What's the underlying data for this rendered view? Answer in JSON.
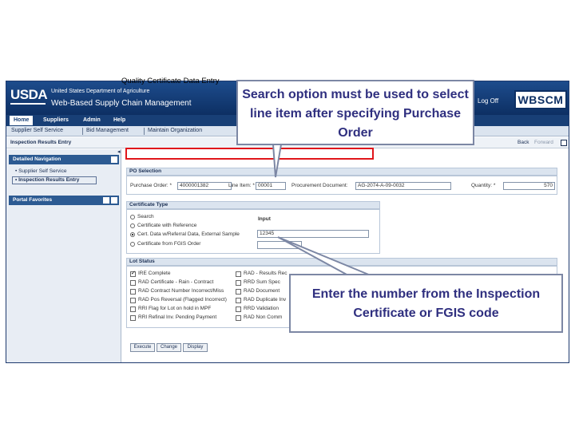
{
  "header": {
    "agency": "USDA",
    "department": "United States Department of Agriculture",
    "system_name": "Web-Based Supply Chain Management",
    "logoff": "Log Off",
    "logo": "WBSCM"
  },
  "top_nav": [
    "Home",
    "Suppliers",
    "Admin",
    "Help"
  ],
  "sub_nav": [
    "Supplier Self Service",
    "Bid Management",
    "Maintain Organization"
  ],
  "path": "Inspection Results Entry",
  "history": {
    "back": "Back",
    "forward": "Forward"
  },
  "left_nav": {
    "detailed_title": "Detailed Navigation",
    "items": [
      "Supplier Self Service",
      "Inspection Results Entry"
    ],
    "portal_title": "Portal Favorites"
  },
  "page_title": "Quality Certificate Data Entry",
  "po_selection": {
    "title": "PO Selection",
    "purchase_order_label": "Purchase Order: *",
    "purchase_order_value": "4000001382",
    "line_item_label": "Line Item: *",
    "line_item_value": "00001",
    "procurement_doc_label": "Procurement Document:",
    "procurement_doc_value": "AG-2074-A-09-0032",
    "quantity_label": "Quantity: *",
    "quantity_value": "570"
  },
  "certificate_type": {
    "title": "Certificate Type",
    "input_header": "Input",
    "options": [
      "Search",
      "Certificate with Reference",
      "Cert. Data w/Referral Data, External Sample",
      "Certificate from FGIS Order"
    ],
    "selected_index": 2,
    "input_value": "12345"
  },
  "lot_status": {
    "title": "Lot Status",
    "left": [
      "IRE Complete",
      "RAD Certificate - Rain - Contract",
      "RAD Contract Number Incorrect/Miss",
      "RAD Pos Reversal (Flagged Incorrect)",
      "RRI Flag for Lot on hold in MPF",
      "RRI Refinal Inv. Pending Payment"
    ],
    "left_checked": [
      true,
      false,
      false,
      false,
      false,
      false
    ],
    "right": [
      "RAD - Results Rec",
      "RRD Sum Spec",
      "RAD Document",
      "RAD Duplicate Inv",
      "RRD Validation",
      "RAD Non Comm"
    ]
  },
  "buttons": [
    "Execute",
    "Change",
    "Display"
  ],
  "callouts": {
    "top": "Search option must be used to select line item after specifying Purchase Order",
    "bottom": "Enter the number from the Inspection Certificate or FGIS code"
  }
}
